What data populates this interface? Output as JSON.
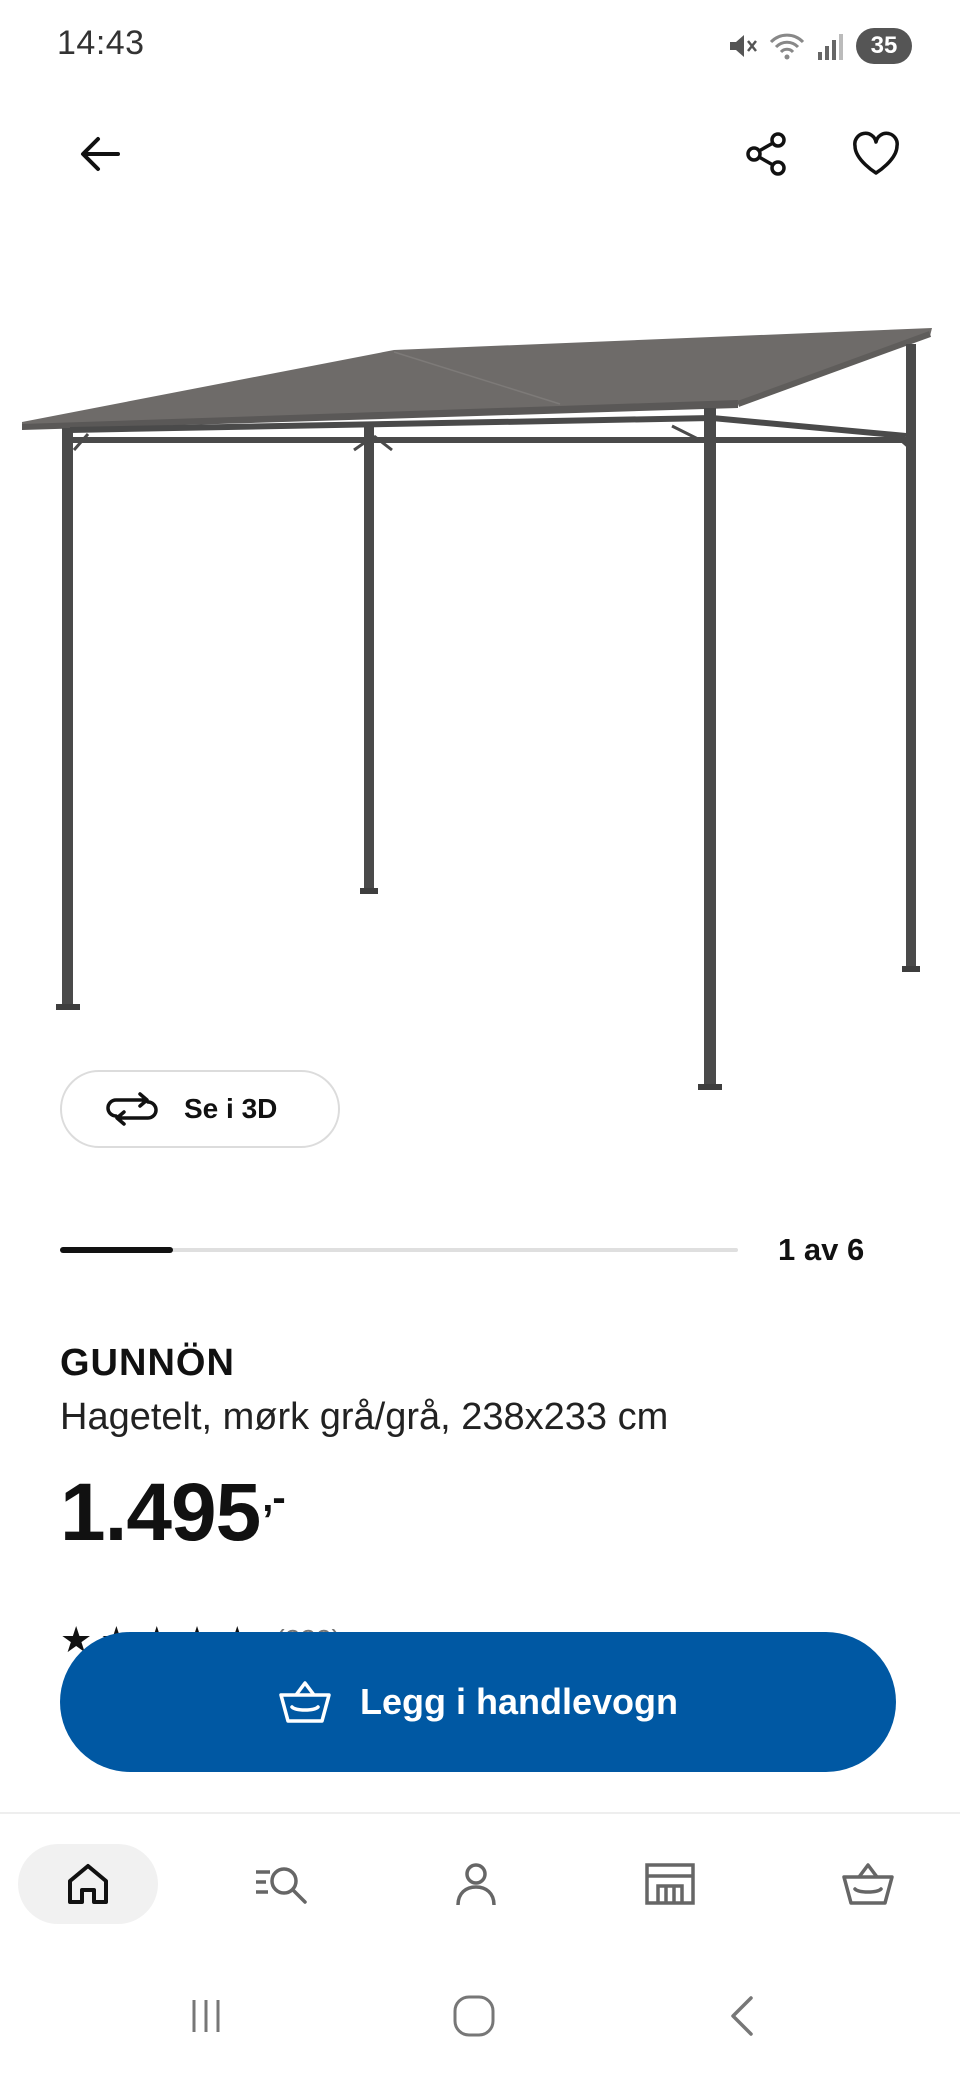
{
  "status_bar": {
    "time": "14:43",
    "battery": "35",
    "icons": [
      "mute-icon",
      "wifi-icon",
      "signal-icon",
      "battery-icon"
    ]
  },
  "header": {
    "icons": [
      "back-arrow-icon",
      "share-icon",
      "heart-icon"
    ]
  },
  "gallery": {
    "view_3d_label": "Se i 3D",
    "current": 1,
    "total": 6,
    "counter_text": "1 av 6",
    "progress_fraction": 0.1667
  },
  "product": {
    "name": "GUNNÖN",
    "description": "Hagetelt, mørk grå/grå, 238x233 cm",
    "price": "1.495",
    "price_suffix": ",-",
    "rating_count": "(222)"
  },
  "cta": {
    "add_to_cart_label": "Legg i handlevogn"
  },
  "bottom_nav": {
    "items": [
      "home-icon",
      "search-icon",
      "profile-icon",
      "store-icon",
      "cart-icon"
    ],
    "active": "home"
  },
  "colors": {
    "primary": "#0058a3",
    "text": "#111111",
    "canopy": "#6e6b69",
    "frame": "#4a4a4a"
  }
}
